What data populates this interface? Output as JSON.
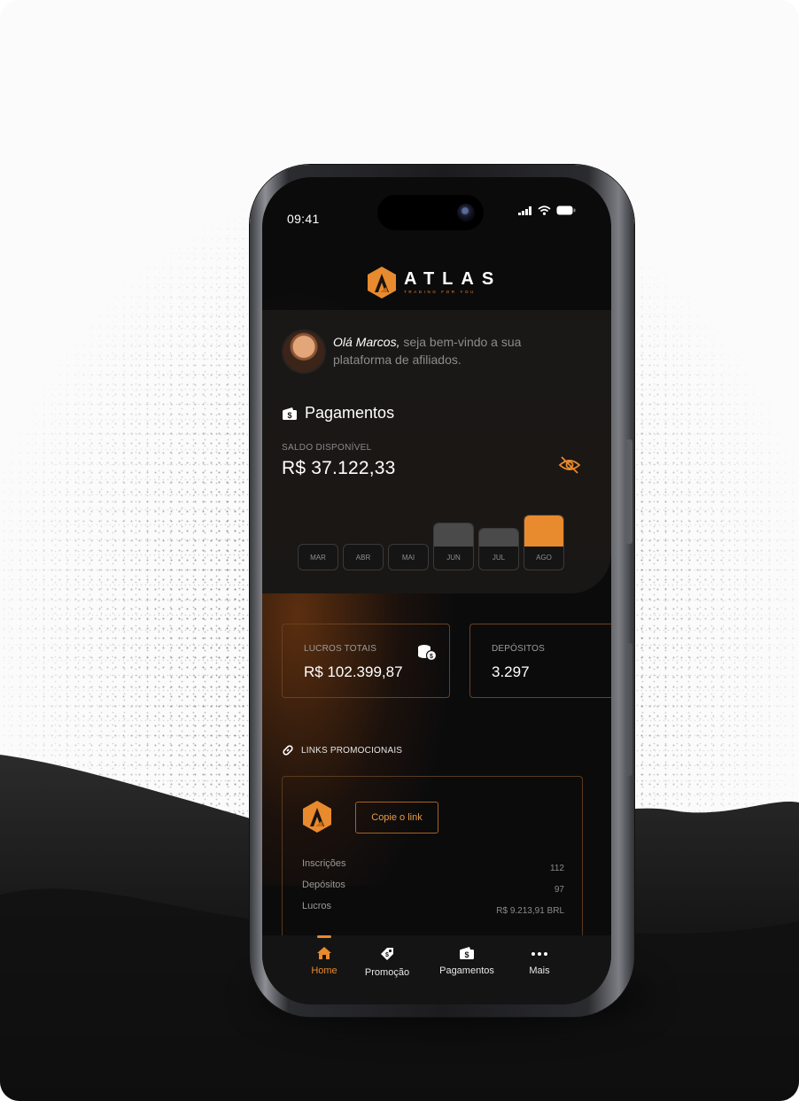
{
  "status_bar": {
    "time": "09:41"
  },
  "brand": {
    "name": "ATLAS",
    "tagline": "TRADING FOR YOU",
    "accent": "#E88A2E"
  },
  "greeting": {
    "name": "Olá Marcos,",
    "message": "seja bem-vindo a sua plataforma de afiliados."
  },
  "payments": {
    "title": "Pagamentos",
    "balance_label": "SALDO DISPONÍVEL",
    "balance_value": "R$ 37.122,33",
    "hide_icon": "eye-off-icon",
    "months": [
      {
        "label": "MAR",
        "level": 0.0,
        "highlight": false
      },
      {
        "label": "ABR",
        "level": 0.0,
        "highlight": false
      },
      {
        "label": "MAI",
        "level": 0.0,
        "highlight": false
      },
      {
        "label": "JUN",
        "level": 0.4,
        "highlight": false
      },
      {
        "label": "JUL",
        "level": 0.3,
        "highlight": false
      },
      {
        "label": "AGO",
        "level": 0.55,
        "highlight": true
      }
    ]
  },
  "stats": {
    "profits": {
      "label": "LUCROS TOTAIS",
      "value": "R$ 102.399,87"
    },
    "deposits": {
      "label": "DEPÓSITOS",
      "value": "3.297"
    }
  },
  "promo_links": {
    "title": "LINKS PROMOCIONAIS",
    "copy_label": "Copie o link",
    "rows": [
      {
        "label": "Inscrições",
        "value": "112"
      },
      {
        "label": "Depósitos",
        "value": "97"
      },
      {
        "label": "Lucros",
        "value": "R$ 9.213,91 BRL"
      }
    ]
  },
  "tabs": [
    {
      "label": "Home",
      "icon": "home-icon",
      "active": true
    },
    {
      "label": "Promoção",
      "icon": "tag-icon",
      "active": false
    },
    {
      "label": "Pagamentos",
      "icon": "wallet-icon",
      "active": false
    },
    {
      "label": "Mais",
      "icon": "more-icon",
      "active": false
    }
  ]
}
